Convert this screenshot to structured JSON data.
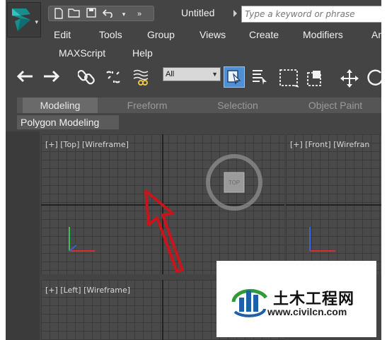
{
  "window": {
    "title": "Untitled",
    "search": {
      "placeholder": "Type a keyword or phrase",
      "value": ""
    }
  },
  "menus": [
    "Edit",
    "Tools",
    "Group",
    "Views",
    "Create",
    "Modifiers",
    "An",
    "MAXScript",
    "Help"
  ],
  "toolbar": {
    "selection_filter": "All"
  },
  "ribbon": {
    "tabs": [
      "Modeling",
      "Freeform",
      "Selection",
      "Object Paint"
    ],
    "active_tab": "Modeling",
    "panel_label": "Polygon Modeling"
  },
  "viewports": {
    "top": {
      "label": "[+] [Top] [Wireframe]",
      "viewcube_label": "TOP"
    },
    "front": {
      "label": "[+] [Front] [Wirefran"
    },
    "left": {
      "label": "[+] [Left] [Wireframe]"
    }
  },
  "watermark": {
    "title": "土木工程网",
    "url": "www.civilcn.com"
  },
  "colors": {
    "accent_select": "#4f8fd6",
    "viewport_bg": "#4a4a4a",
    "annotation_arrow": "#c8141a",
    "watermark_blue": "#1d5fa8",
    "watermark_green": "#2e9a3a"
  }
}
